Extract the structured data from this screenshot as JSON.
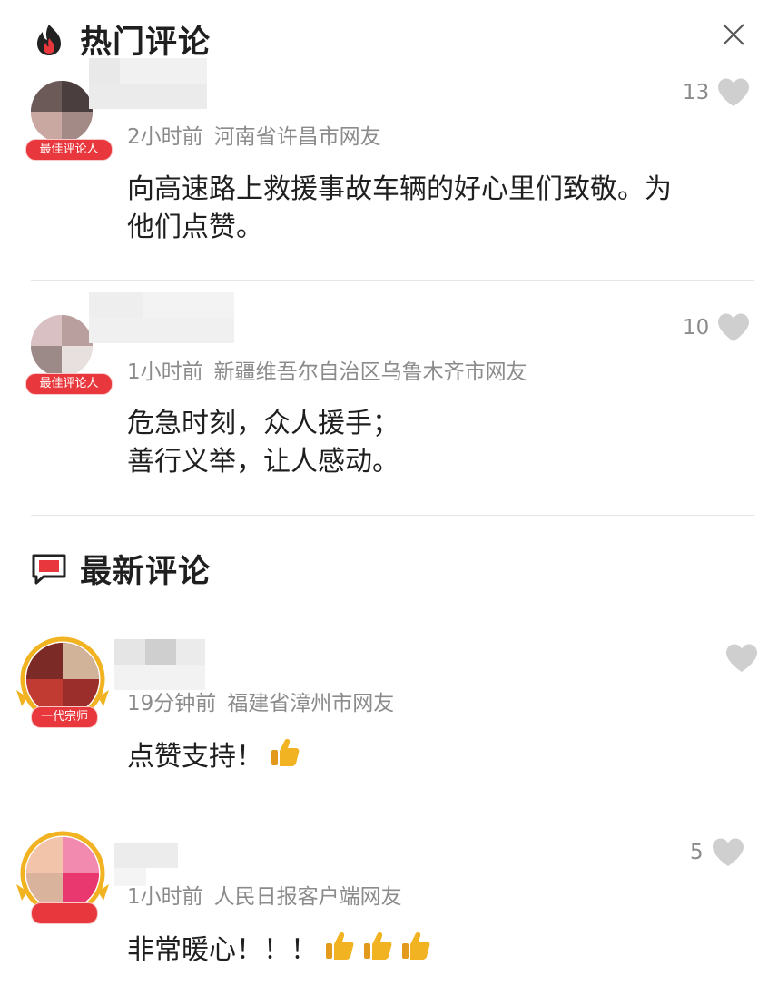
{
  "hot_section": {
    "title": "热门评论",
    "icon": "fire-icon"
  },
  "new_section": {
    "title": "最新评论",
    "icon": "chat-bubble-icon"
  },
  "close_icon": "close-icon",
  "colors": {
    "accent": "#e8383d",
    "meta_text": "#8b8b8b",
    "like_icon": "#cfcfcf",
    "thumbs": "#f2b322"
  },
  "hot_comments": [
    {
      "time": "2小时前",
      "location": "河南省许昌市网友",
      "badge": "最佳评论人",
      "likes": "13",
      "content": [
        "向高速路上救援事故车辆的好心里们致敬。为",
        "他们点赞。"
      ]
    },
    {
      "time": "1小时前",
      "location": "新疆维吾尔自治区乌鲁木齐市网友",
      "badge": "最佳评论人",
      "likes": "10",
      "content": [
        "危急时刻，众人援手；",
        "善行义举，让人感动。"
      ]
    }
  ],
  "new_comments": [
    {
      "time": "19分钟前",
      "location": "福建省漳州市网友",
      "badge": "一代宗师",
      "likes": "",
      "content": [
        "点赞支持！"
      ],
      "thumbs_count": 1
    },
    {
      "time": "1小时前",
      "location": "人民日报客户端网友",
      "badge": "",
      "likes": "5",
      "content": [
        "非常暖心！！！"
      ],
      "thumbs_count": 3
    }
  ]
}
